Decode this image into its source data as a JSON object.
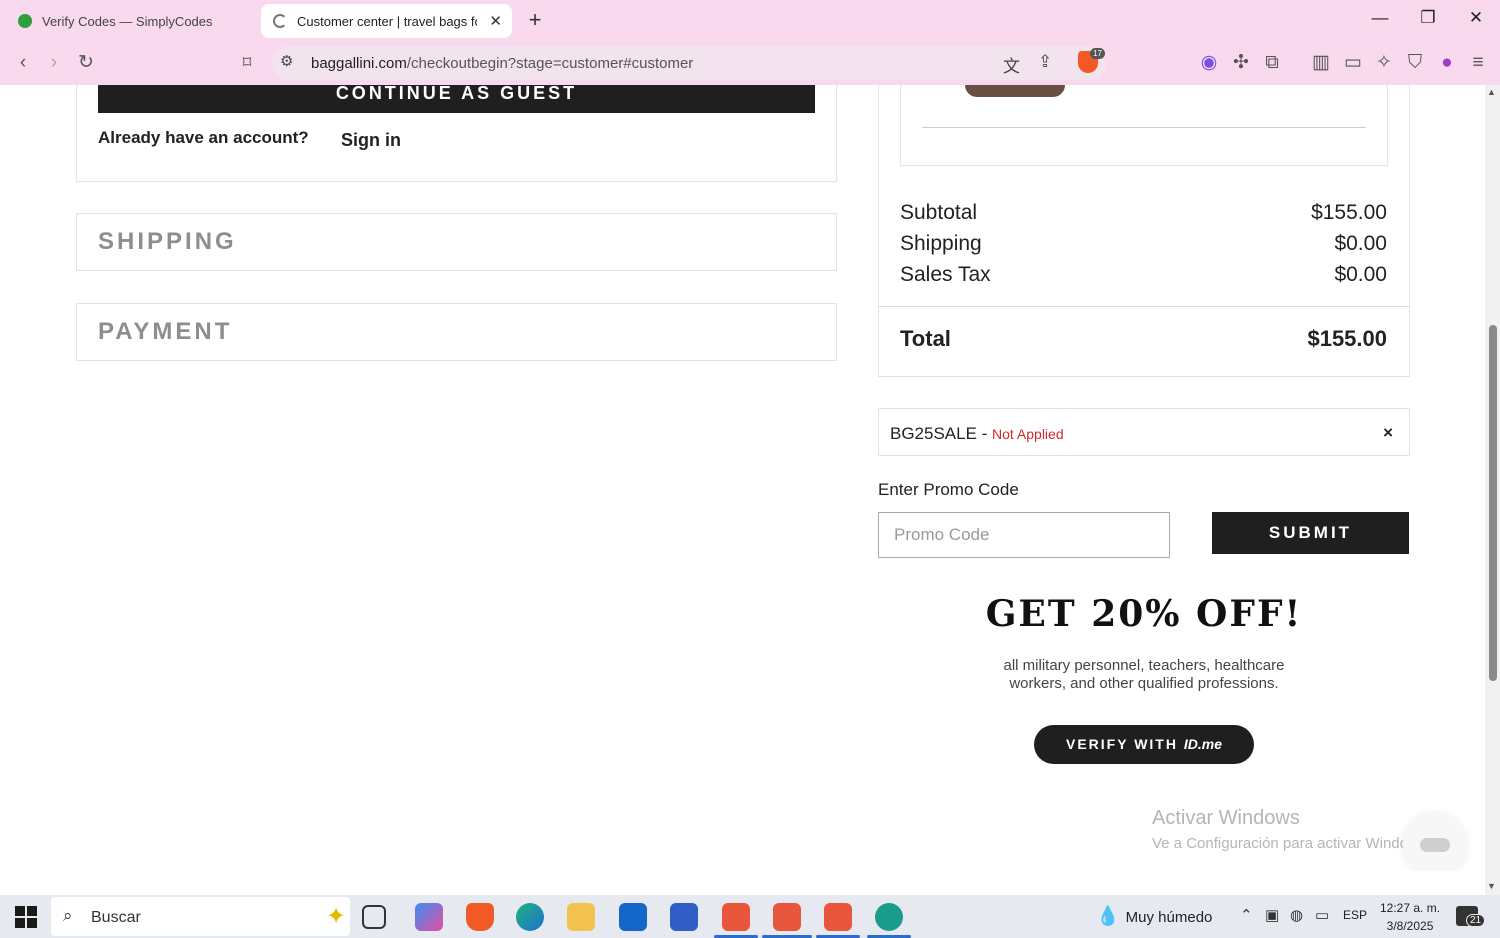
{
  "browser": {
    "tabs": [
      {
        "label": "Verify Codes — SimplyCodes",
        "active": false
      },
      {
        "label": "Customer center | travel bags for",
        "active": true
      }
    ],
    "new_tab": "+",
    "url_host": "baggallini.com",
    "url_path": "/checkoutbegin?stage=customer#customer",
    "shield_count": "17",
    "window_controls": {
      "minimize": "—",
      "maximize": "❐",
      "close": "✕"
    }
  },
  "checkout": {
    "continue_guest": "CONTINUE AS GUEST",
    "already_account": "Already have an account?",
    "sign_in": "Sign in",
    "sections": {
      "shipping": "SHIPPING",
      "payment": "PAYMENT"
    }
  },
  "summary": {
    "subtotal_label": "Subtotal",
    "subtotal_value": "$155.00",
    "shipping_label": "Shipping",
    "shipping_value": "$0.00",
    "tax_label": "Sales Tax",
    "tax_value": "$0.00",
    "total_label": "Total",
    "total_value": "$155.00"
  },
  "promo": {
    "applied_code": "BG25SALE",
    "applied_separator": "-",
    "applied_status": "Not Applied",
    "remove": "×",
    "enter_label": "Enter Promo Code",
    "placeholder": "Promo Code",
    "submit": "SUBMIT"
  },
  "offer": {
    "title": "GET 20% OFF!",
    "text": "all military personnel, teachers, healthcare workers, and other qualified professions.",
    "verify_prefix": "VERIFY WITH",
    "verify_brand": "ID.me"
  },
  "watermark": {
    "line1": "Activar Windows",
    "line2": "Ve a Configuración para activar Windows."
  },
  "taskbar": {
    "search_text": "Buscar",
    "weather": "Muy húmedo",
    "language": "ESP",
    "time": "12:27 a. m.",
    "date": "3/8/2025",
    "notifications": "21"
  },
  "colors": {
    "chrome": "#f8d9ee",
    "status_error": "#d12a2a",
    "button_dark": "#1f1f1f"
  }
}
